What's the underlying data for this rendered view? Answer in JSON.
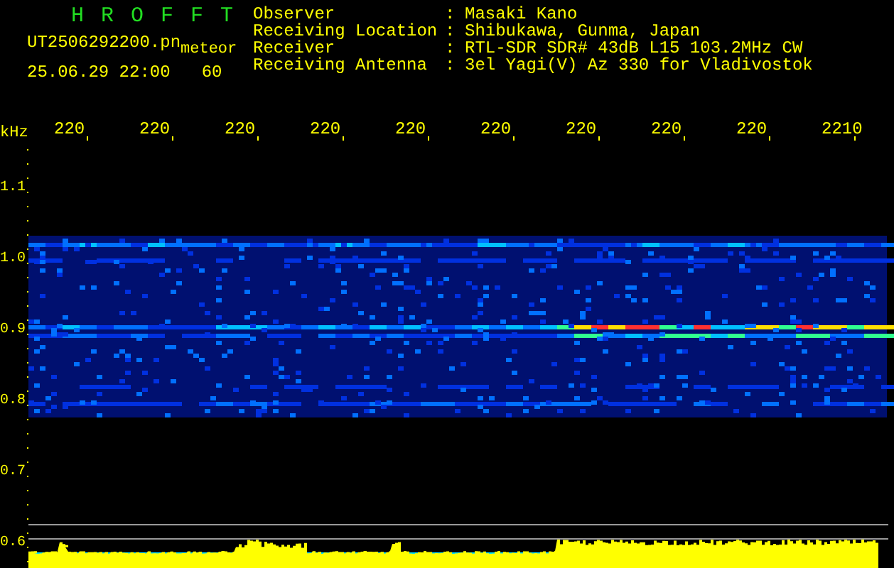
{
  "header": {
    "title": "H R O F F T",
    "file_name": "UT2506292200.pn",
    "mode": "meteor",
    "date_time": "25.06.29 22:00",
    "interval": "60"
  },
  "station_info": [
    {
      "label": "Observer",
      "separator": ":",
      "value": "Masaki Kano"
    },
    {
      "label": "Receiving Location",
      "separator": ":",
      "value": "Shibukawa, Gunma, Japan"
    },
    {
      "label": "Receiver",
      "separator": ":",
      "value": "RTL-SDR SDR# 43dB L15 103.2MHz CW"
    },
    {
      "label": "Receiving Antenna",
      "separator": ":",
      "value": "3el Yagi(V) Az 330 for Vladivostok"
    }
  ],
  "waterfall": {
    "y_unit": "kHz",
    "time_labels": [
      "220",
      "220",
      "220",
      "220",
      "220",
      "220",
      "220",
      "220",
      "220",
      "2210"
    ],
    "frequency_labels": [
      "1.1",
      "1.0",
      "0.9",
      "0.8",
      "0.7",
      "0.6"
    ]
  }
}
